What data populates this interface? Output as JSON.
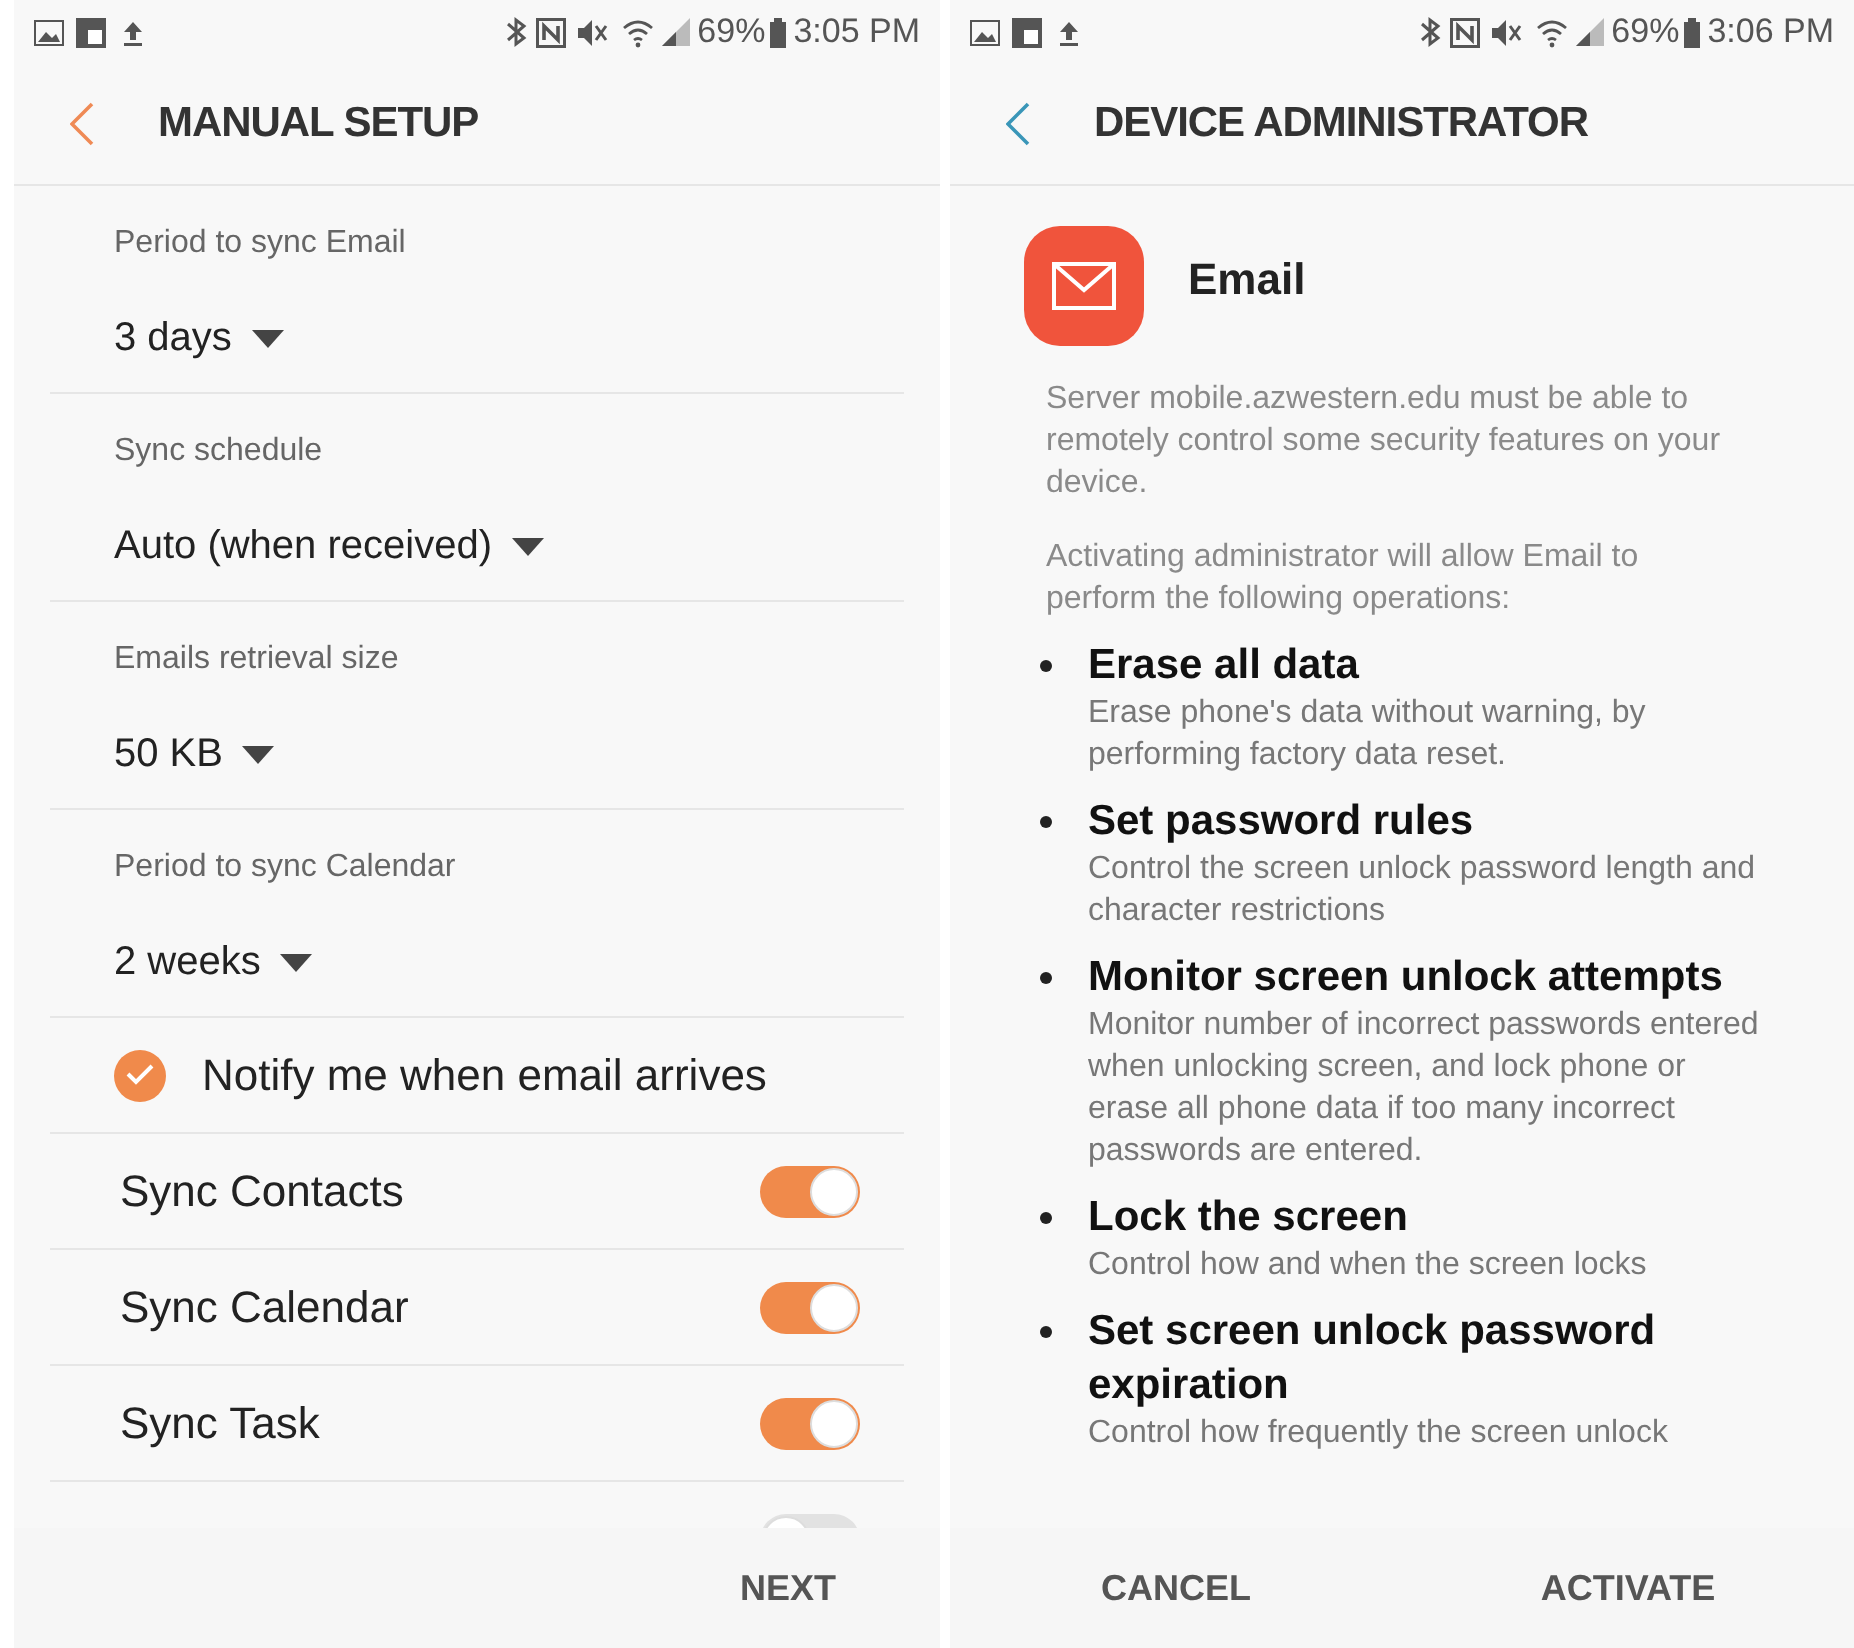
{
  "screens": [
    {
      "kind": "settings",
      "status_bar": {
        "battery": "69%",
        "time": "3:05 PM"
      },
      "title": "MANUAL SETUP",
      "settings": [
        {
          "kind": "dropdown",
          "label": "Period to sync Email",
          "value": "3 days"
        },
        {
          "kind": "dropdown",
          "label": "Sync schedule",
          "value": "Auto (when received)"
        },
        {
          "kind": "dropdown",
          "label": "Emails retrieval size",
          "value": "50 KB"
        },
        {
          "kind": "dropdown",
          "label": "Period to sync Calendar",
          "value": "2 weeks"
        },
        {
          "kind": "check",
          "label": "Notify me when email arrives",
          "checked": true
        },
        {
          "kind": "toggle",
          "label": "Sync Contacts",
          "on": true
        },
        {
          "kind": "toggle",
          "label": "Sync Calendar",
          "on": true
        },
        {
          "kind": "toggle",
          "label": "Sync Task",
          "on": true
        },
        {
          "kind": "toggle",
          "on": false
        }
      ],
      "buttons": [
        "NEXT"
      ]
    },
    {
      "kind": "admin",
      "status_bar": {
        "battery": "69%",
        "time": "3:06 PM"
      },
      "title": "DEVICE ADMINISTRATOR",
      "app_name": "Email",
      "paragraphs": [
        "Server mobile.azwestern.edu must be able to remotely control some security features on your device.",
        "Activating administrator will allow Email to perform the following operations:"
      ],
      "operations": [
        {
          "title": "Erase all data",
          "description": "Erase phone's data without warning, by performing factory data reset."
        },
        {
          "title": "Set password rules",
          "description": "Control the screen unlock password length and character restrictions"
        },
        {
          "title": "Monitor screen unlock attempts",
          "description": "Monitor number of incorrect passwords entered when unlocking screen, and lock phone or erase all phone data if too many incorrect passwords are entered."
        },
        {
          "title": "Lock the screen",
          "description": "Control how and when the screen locks"
        },
        {
          "title": "Set screen unlock password expiration",
          "description": "Control how frequently the screen unlock"
        }
      ],
      "buttons": [
        "CANCEL",
        "ACTIVATE"
      ]
    }
  ]
}
